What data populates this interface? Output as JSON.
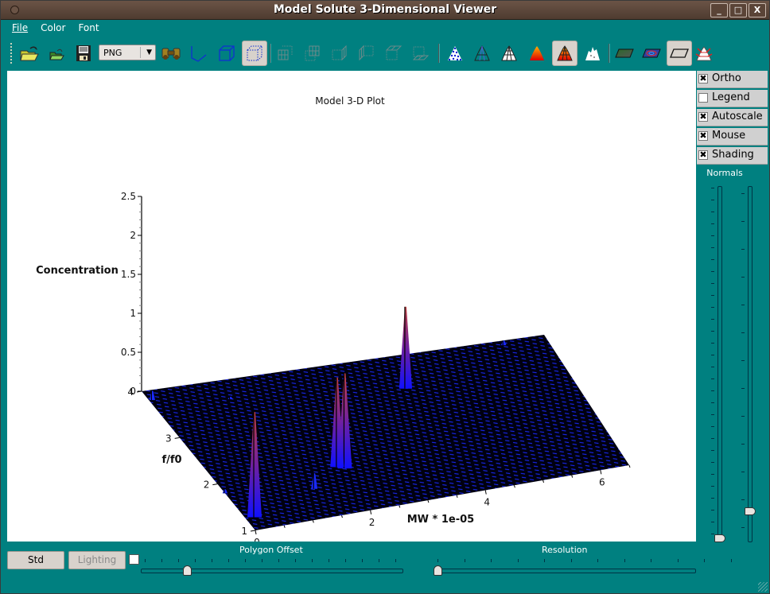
{
  "window": {
    "title": "Model Solute 3-Dimensional Viewer",
    "controls": {
      "minimize": "_",
      "maximize": "□",
      "close": "X"
    }
  },
  "menu": [
    {
      "label": "File",
      "mnemonic": "F"
    },
    {
      "label": "Color",
      "mnemonic": "C"
    },
    {
      "label": "Font",
      "mnemonic": ""
    }
  ],
  "toolbar": {
    "format_select": {
      "value": "PNG"
    },
    "buttons": [
      {
        "id": "open",
        "icon": "open-folder-icon",
        "active": false,
        "enabled": true
      },
      {
        "id": "open-small",
        "icon": "open-folder-small-icon",
        "active": false,
        "enabled": true
      },
      {
        "id": "save",
        "icon": "floppy-disk-icon",
        "active": false,
        "enabled": true
      },
      {
        "id": "binoculars",
        "icon": "binoculars-icon",
        "active": false,
        "enabled": true
      },
      {
        "id": "axes",
        "icon": "axes-icon",
        "active": false,
        "enabled": true
      },
      {
        "id": "box",
        "icon": "box-icon",
        "active": false,
        "enabled": true
      },
      {
        "id": "frame",
        "icon": "frame-icon",
        "active": true,
        "enabled": true
      },
      {
        "id": "grid-back",
        "icon": "grid-back-icon",
        "active": false,
        "enabled": false
      },
      {
        "id": "grid-front",
        "icon": "grid-front-icon",
        "active": false,
        "enabled": false
      },
      {
        "id": "grid-right",
        "icon": "grid-right-icon",
        "active": false,
        "enabled": false
      },
      {
        "id": "grid-left",
        "icon": "grid-left-icon",
        "active": false,
        "enabled": false
      },
      {
        "id": "grid-ceil",
        "icon": "grid-ceil-icon",
        "active": false,
        "enabled": false
      },
      {
        "id": "grid-floor",
        "icon": "grid-floor-icon",
        "active": false,
        "enabled": false
      },
      {
        "id": "points",
        "icon": "point-cloud-icon",
        "active": false,
        "enabled": true
      },
      {
        "id": "wireframe",
        "icon": "wireframe-icon",
        "active": false,
        "enabled": true
      },
      {
        "id": "hidden-line",
        "icon": "hidden-line-icon",
        "active": false,
        "enabled": true
      },
      {
        "id": "filled",
        "icon": "filled-polygons-icon",
        "active": false,
        "enabled": true
      },
      {
        "id": "filled-mesh",
        "icon": "filled-mesh-icon",
        "active": true,
        "enabled": true
      },
      {
        "id": "no-mesh",
        "icon": "no-mesh-icon",
        "active": false,
        "enabled": true
      },
      {
        "id": "floor-data",
        "icon": "floor-data-icon",
        "active": false,
        "enabled": true
      },
      {
        "id": "floor-iso",
        "icon": "floor-isolines-icon",
        "active": false,
        "enabled": true
      },
      {
        "id": "floor-empty",
        "icon": "floor-empty-icon",
        "active": true,
        "enabled": true
      },
      {
        "id": "normals",
        "icon": "normals-icon",
        "active": false,
        "enabled": true
      }
    ]
  },
  "options": [
    {
      "label": "Ortho",
      "checked": true
    },
    {
      "label": "Legend",
      "checked": false
    },
    {
      "label": "Autoscale",
      "checked": true
    },
    {
      "label": "Mouse",
      "checked": true
    },
    {
      "label": "Shading",
      "checked": true
    }
  ],
  "normals": {
    "label": "Normals",
    "length_slider": {
      "value": 0.0
    },
    "quality_slider": {
      "value": 0.08
    }
  },
  "bottom": {
    "std_button": "Std",
    "lighting_button": "Lighting",
    "lighting_enabled": false,
    "polygon_offset_checkbox": false,
    "polygon_offset": {
      "label": "Polygon Offset",
      "value": 0.17
    },
    "resolution": {
      "label": "Resolution",
      "value": 0.0
    }
  },
  "chart_data": {
    "type": "surface3d",
    "title": "Model 3-D Plot",
    "xlabel": "MW * 1e-05",
    "ylabel": "f/f0",
    "zlabel": "Concentration",
    "xlim": [
      0,
      6.5
    ],
    "ylim": [
      1,
      4
    ],
    "zlim": [
      0,
      2.5
    ],
    "xticks": [
      "0",
      "2",
      "4",
      "6"
    ],
    "yticks": [
      "1",
      "2",
      "3",
      "4"
    ],
    "zticks": [
      "0",
      "0.5",
      "1",
      "1.5",
      "2",
      "2.5"
    ],
    "grid": false,
    "peaks": [
      {
        "mw": 0.15,
        "ff0": 1.25,
        "concentration": 1.35
      },
      {
        "mw": 2.1,
        "ff0": 1.9,
        "concentration": 1.22
      },
      {
        "mw": 2.0,
        "ff0": 1.95,
        "concentration": 1.15
      },
      {
        "mw": 3.9,
        "ff0": 3.3,
        "concentration": 1.05
      },
      {
        "mw": 1.4,
        "ff0": 1.6,
        "concentration": 0.2
      },
      {
        "mw": 0.05,
        "ff0": 3.8,
        "concentration": 0.12
      },
      {
        "mw": 0.0,
        "ff0": 1.8,
        "concentration": 0.05
      },
      {
        "mw": 5.8,
        "ff0": 3.9,
        "concentration": 0.06
      },
      {
        "mw": 1.2,
        "ff0": 3.6,
        "concentration": 0.03
      }
    ],
    "colors": {
      "surface": "#0000cc",
      "mesh": "#000000",
      "peak_top": "#c04040"
    }
  }
}
